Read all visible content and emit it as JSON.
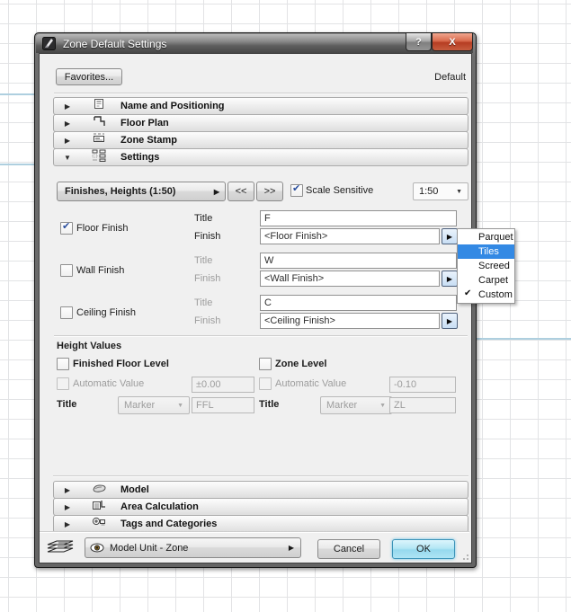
{
  "window": {
    "title": "Zone Default Settings",
    "help": "?",
    "close": "X",
    "favorites": "Favorites...",
    "default_badge": "Default"
  },
  "icons": {
    "collapsed": "▶",
    "expanded": "▼",
    "dropdown": "▼",
    "flyout": "▶",
    "check": "✔"
  },
  "sections": [
    {
      "label": "Name and Positioning",
      "state": "collapsed"
    },
    {
      "label": "Floor Plan",
      "state": "collapsed"
    },
    {
      "label": "Zone Stamp",
      "state": "collapsed"
    },
    {
      "label": "Settings",
      "state": "expanded"
    }
  ],
  "settings": {
    "preset": "Finishes, Heights (1:50)",
    "prev": "<<",
    "next": ">>",
    "scale_sensitive": {
      "label": "Scale Sensitive",
      "checked": true
    },
    "scale": "1:50",
    "rows": [
      {
        "label": "Floor Finish",
        "checked": true,
        "title_label": "Title",
        "title": "F",
        "finish_label": "Finish",
        "finish": "<Floor Finish>"
      },
      {
        "label": "Wall Finish",
        "checked": false,
        "title_label": "Title",
        "title": "W",
        "finish_label": "Finish",
        "finish": "<Wall Finish>"
      },
      {
        "label": "Ceiling Finish",
        "checked": false,
        "title_label": "Title",
        "title": "C",
        "finish_label": "Finish",
        "finish": "<Ceiling Finish>"
      }
    ],
    "height_values": {
      "heading": "Height Values",
      "columns": [
        {
          "level": "Finished Floor Level",
          "checked": false,
          "auto": "Automatic Value",
          "auto_checked": false,
          "value": "±0.00",
          "title_label": "Title",
          "marker": "Marker",
          "title": "FFL"
        },
        {
          "level": "Zone Level",
          "checked": false,
          "auto": "Automatic Value",
          "auto_checked": false,
          "value": "-0.10",
          "title_label": "Title",
          "marker": "Marker",
          "title": "ZL"
        }
      ]
    }
  },
  "menu": {
    "items": [
      {
        "label": "Parquet",
        "highlighted": false,
        "checked": false
      },
      {
        "label": "Tiles",
        "highlighted": true,
        "checked": false
      },
      {
        "label": "Screed",
        "highlighted": false,
        "checked": false
      },
      {
        "label": "Carpet",
        "highlighted": false,
        "checked": false
      },
      {
        "label": "Custom",
        "highlighted": false,
        "checked": true
      }
    ]
  },
  "bottom_sections": [
    {
      "label": "Model",
      "state": "collapsed"
    },
    {
      "label": "Area Calculation",
      "state": "collapsed"
    },
    {
      "label": "Tags and Categories",
      "state": "collapsed"
    }
  ],
  "footer": {
    "model_unit": "Model Unit - Zone",
    "cancel": "Cancel",
    "ok": "OK"
  },
  "colors": {
    "menu_highlight": "#3389e4",
    "ok_accent": "#aee4f4",
    "close_button": "#c75d3f",
    "titlebar": "#5e5e5e",
    "client_bg": "#f0f0f0"
  }
}
